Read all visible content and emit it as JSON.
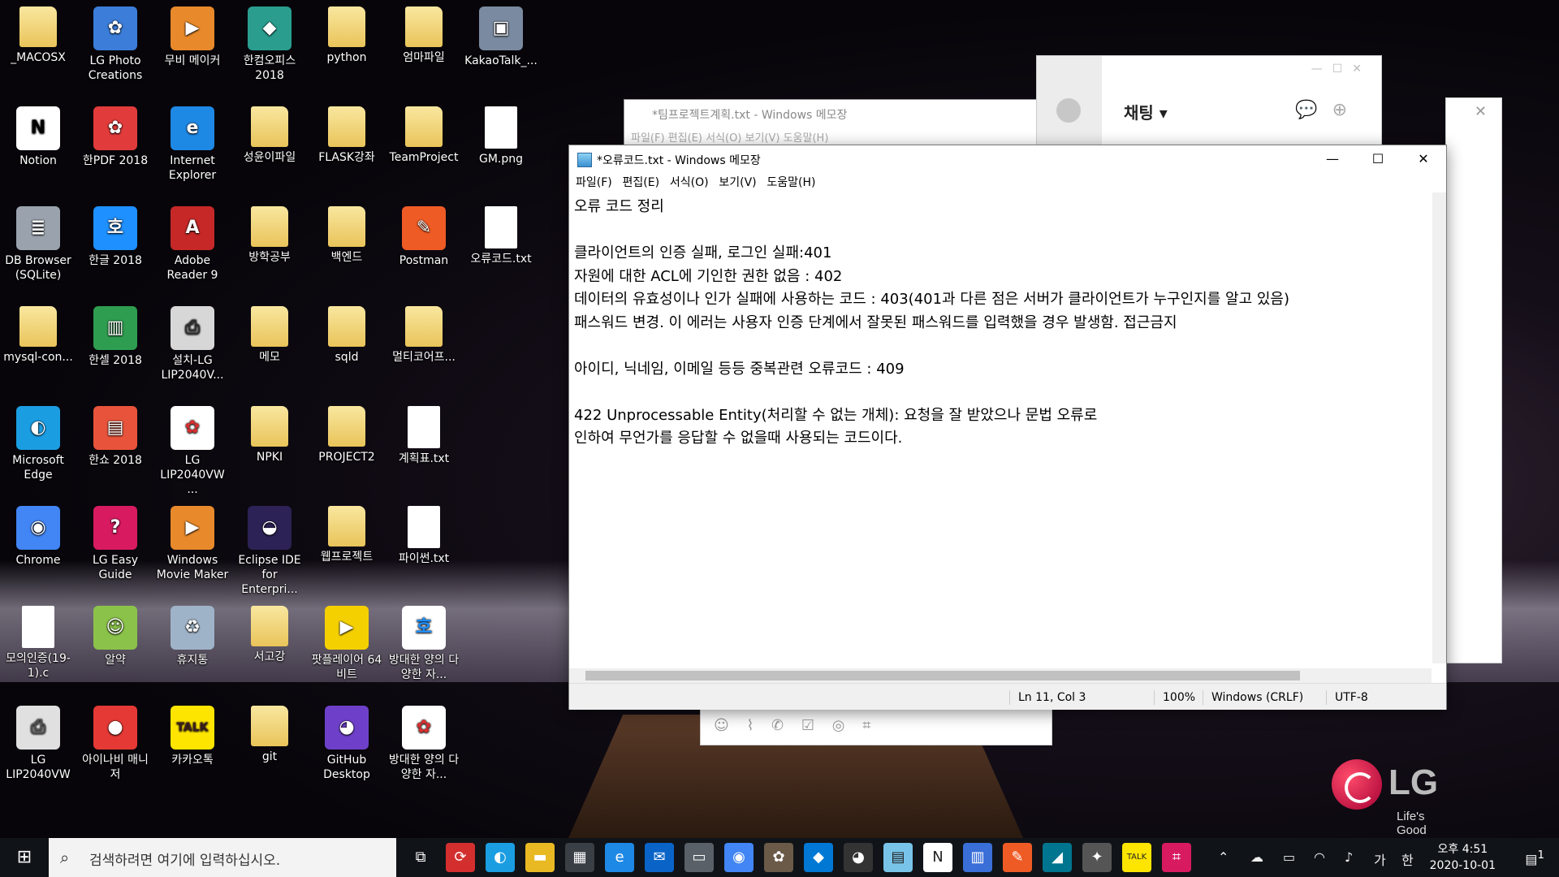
{
  "desktop_icons": [
    {
      "label": "_MACOSX",
      "kind": "folder"
    },
    {
      "label": "LG Photo Creations",
      "kind": "app",
      "color": "#3b7dd8",
      "glyph": "✿"
    },
    {
      "label": "무비 메이커",
      "kind": "app",
      "color": "#e8892b",
      "glyph": "▶"
    },
    {
      "label": "한컴오피스 2018",
      "kind": "app",
      "color": "#2a9d8f",
      "glyph": "◆"
    },
    {
      "label": "python",
      "kind": "folder"
    },
    {
      "label": "엄마파일",
      "kind": "folder"
    },
    {
      "label": "KakaoTalk_...",
      "kind": "app",
      "color": "#7a8aa0",
      "glyph": "▣"
    },
    {
      "label": "Notion",
      "kind": "app",
      "color": "#ffffff",
      "glyph": "N",
      "fg": "#000"
    },
    {
      "label": "한PDF 2018",
      "kind": "app",
      "color": "#e13b3b",
      "glyph": "✿"
    },
    {
      "label": "Internet Explorer",
      "kind": "app",
      "color": "#1e88e5",
      "glyph": "e"
    },
    {
      "label": "성윤이파일",
      "kind": "folder"
    },
    {
      "label": "FLASK강좌",
      "kind": "folder"
    },
    {
      "label": "TeamProject",
      "kind": "folder"
    },
    {
      "label": "GM.png",
      "kind": "doc"
    },
    {
      "label": "DB Browser (SQLite)",
      "kind": "app",
      "color": "#9aa3ad",
      "glyph": "≣"
    },
    {
      "label": "한글 2018",
      "kind": "app",
      "color": "#1e90ff",
      "glyph": "호"
    },
    {
      "label": "Adobe Reader 9",
      "kind": "app",
      "color": "#c62828",
      "glyph": "A"
    },
    {
      "label": "방학공부",
      "kind": "folder"
    },
    {
      "label": "백엔드",
      "kind": "folder"
    },
    {
      "label": "Postman",
      "kind": "app",
      "color": "#ef5b25",
      "glyph": "✎"
    },
    {
      "label": "오류코드.txt",
      "kind": "doc"
    },
    {
      "label": "mysql-con...",
      "kind": "folder"
    },
    {
      "label": "한셀 2018",
      "kind": "app",
      "color": "#2e9d4f",
      "glyph": "▥"
    },
    {
      "label": "설치-LG LIP2040V...",
      "kind": "app",
      "color": "#d7d7d7",
      "glyph": "⎙",
      "fg": "#333"
    },
    {
      "label": "메모",
      "kind": "folder"
    },
    {
      "label": "sqld",
      "kind": "folder"
    },
    {
      "label": "멀티코어프...",
      "kind": "folder"
    },
    {
      "label": "Microsoft Edge",
      "kind": "app",
      "color": "#1b9de2",
      "glyph": "◐"
    },
    {
      "label": "한쇼 2018",
      "kind": "app",
      "color": "#e8533b",
      "glyph": "▤"
    },
    {
      "label": "LG LIP2040VW ...",
      "kind": "app",
      "color": "#ffffff",
      "glyph": "✿",
      "fg": "#d32f2f"
    },
    {
      "label": "NPKI",
      "kind": "folder"
    },
    {
      "label": "PROJECT2",
      "kind": "folder"
    },
    {
      "label": "계획표.txt",
      "kind": "doc"
    },
    {
      "label": "Chrome",
      "kind": "app",
      "color": "#4285f4",
      "glyph": "◉"
    },
    {
      "label": "LG Easy Guide",
      "kind": "app",
      "color": "#d81b60",
      "glyph": "?"
    },
    {
      "label": "Windows Movie Maker",
      "kind": "app",
      "color": "#e8892b",
      "glyph": "▶"
    },
    {
      "label": "Eclipse IDE for Enterpri...",
      "kind": "app",
      "color": "#2c2255",
      "glyph": "◒"
    },
    {
      "label": "웹프로젝트",
      "kind": "folder"
    },
    {
      "label": "파이썬.txt",
      "kind": "doc"
    },
    {
      "label": "모의인증(19-1).c",
      "kind": "doc"
    },
    {
      "label": "알약",
      "kind": "app",
      "color": "#8bc34a",
      "glyph": "☺"
    },
    {
      "label": "휴지통",
      "kind": "app",
      "color": "#9fb3c8",
      "glyph": "♻"
    },
    {
      "label": "서고강",
      "kind": "folder"
    },
    {
      "label": "팟플레이어 64 비트",
      "kind": "app",
      "color": "#f5d000",
      "glyph": "▶"
    },
    {
      "label": "방대한 양의 다양한 자...",
      "kind": "app",
      "color": "#ffffff",
      "glyph": "호",
      "fg": "#1e90ff"
    },
    {
      "label": "LG LIP2040VW",
      "kind": "app",
      "color": "#e0e0e0",
      "glyph": "⎙",
      "fg": "#555"
    },
    {
      "label": "아이나비 매니저",
      "kind": "app",
      "color": "#e53935",
      "glyph": "●"
    },
    {
      "label": "카카오톡",
      "kind": "app",
      "color": "#fee500",
      "glyph": "TALK",
      "fg": "#3c1e1e"
    },
    {
      "label": "git",
      "kind": "folder"
    },
    {
      "label": "GitHub Desktop",
      "kind": "app",
      "color": "#6e40c9",
      "glyph": "◕"
    },
    {
      "label": "방대한 양의 다양한 자...",
      "kind": "app",
      "color": "#ffffff",
      "glyph": "✿",
      "fg": "#d32f2f"
    }
  ],
  "back_notepad": {
    "title": "*팀프로젝트계획.txt - Windows 메모장",
    "menu": "파일(F)   편집(E)   서식(O)   보기(V)   도움말(H)"
  },
  "chat": {
    "title": "채팅 ▾"
  },
  "notepad": {
    "title": "*오류코드.txt - Windows 메모장",
    "menu": [
      "파일(F)",
      "편집(E)",
      "서식(O)",
      "보기(V)",
      "도움말(H)"
    ],
    "lines": [
      "오류 코드 정리",
      "",
      "클라이언트의 인증 실패, 로그인 실패:401",
      "자원에 대한 ACL에 기인한 권한 없음 : 402",
      "데이터의 유효성이나 인가 실패에 사용하는 코드 : 403(401과 다른 점은 서버가 클라이언트가 누구인지를 알고 있음)",
      "패스워드 변경. 이 에러는 사용자 인증 단계에서 잘못된 패스워드를 입력했을 경우 발생함. 접근금지",
      "",
      "아이디, 닉네임, 이메일 등등 중복관련 오류코드 : 409",
      "",
      "422 Unprocessable Entity(처리할 수 없는 개체): 요청을 잘 받았으나 문법 오류로",
      "인하여 무언가를 응답할 수 없을때 사용되는 코드이다."
    ],
    "status": {
      "position": "Ln 11, Col 3",
      "zoom": "100%",
      "eol": "Windows (CRLF)",
      "encoding": "UTF-8"
    }
  },
  "lg": {
    "brand": "LG",
    "slogan": "Life's Good"
  },
  "taskbar": {
    "search_placeholder": "검색하려면 여기에 입력하십시오.",
    "apps": [
      {
        "name": "task-view",
        "glyph": "⧉",
        "color": "#101418"
      },
      {
        "name": "sync-app",
        "glyph": "⟳",
        "color": "#d32f2f"
      },
      {
        "name": "edge",
        "glyph": "◐",
        "color": "#1b9de2"
      },
      {
        "name": "file-explorer",
        "glyph": "▬",
        "color": "#e8b923"
      },
      {
        "name": "store",
        "glyph": "▦",
        "color": "#3a3f45"
      },
      {
        "name": "internet-explorer",
        "glyph": "e",
        "color": "#1e88e5"
      },
      {
        "name": "mail",
        "glyph": "✉",
        "color": "#0a64c8"
      },
      {
        "name": "photos",
        "glyph": "▭",
        "color": "#5a6068"
      },
      {
        "name": "chrome",
        "glyph": "◉",
        "color": "#4285f4"
      },
      {
        "name": "paint",
        "glyph": "✿",
        "color": "#6b5a48"
      },
      {
        "name": "vscode",
        "glyph": "◆",
        "color": "#0078d4"
      },
      {
        "name": "github",
        "glyph": "◕",
        "color": "#333"
      },
      {
        "name": "notepad",
        "glyph": "▤",
        "color": "#78c4e8"
      },
      {
        "name": "notion",
        "glyph": "N",
        "color": "#ffffff"
      },
      {
        "name": "files",
        "glyph": "▥",
        "color": "#3a6fd8"
      },
      {
        "name": "postman",
        "glyph": "✎",
        "color": "#ef5b25"
      },
      {
        "name": "mysql",
        "glyph": "◢",
        "color": "#00758f"
      },
      {
        "name": "paint-app",
        "glyph": "✦",
        "color": "#555"
      },
      {
        "name": "kakaotalk",
        "glyph": "TALK",
        "color": "#fee500"
      },
      {
        "name": "kakao-tool",
        "glyph": "⌗",
        "color": "#d81b60"
      }
    ],
    "tray": {
      "lang": "가",
      "ime": "한",
      "time": "오후 4:51",
      "date": "2020-10-01",
      "notifications": "1"
    }
  }
}
